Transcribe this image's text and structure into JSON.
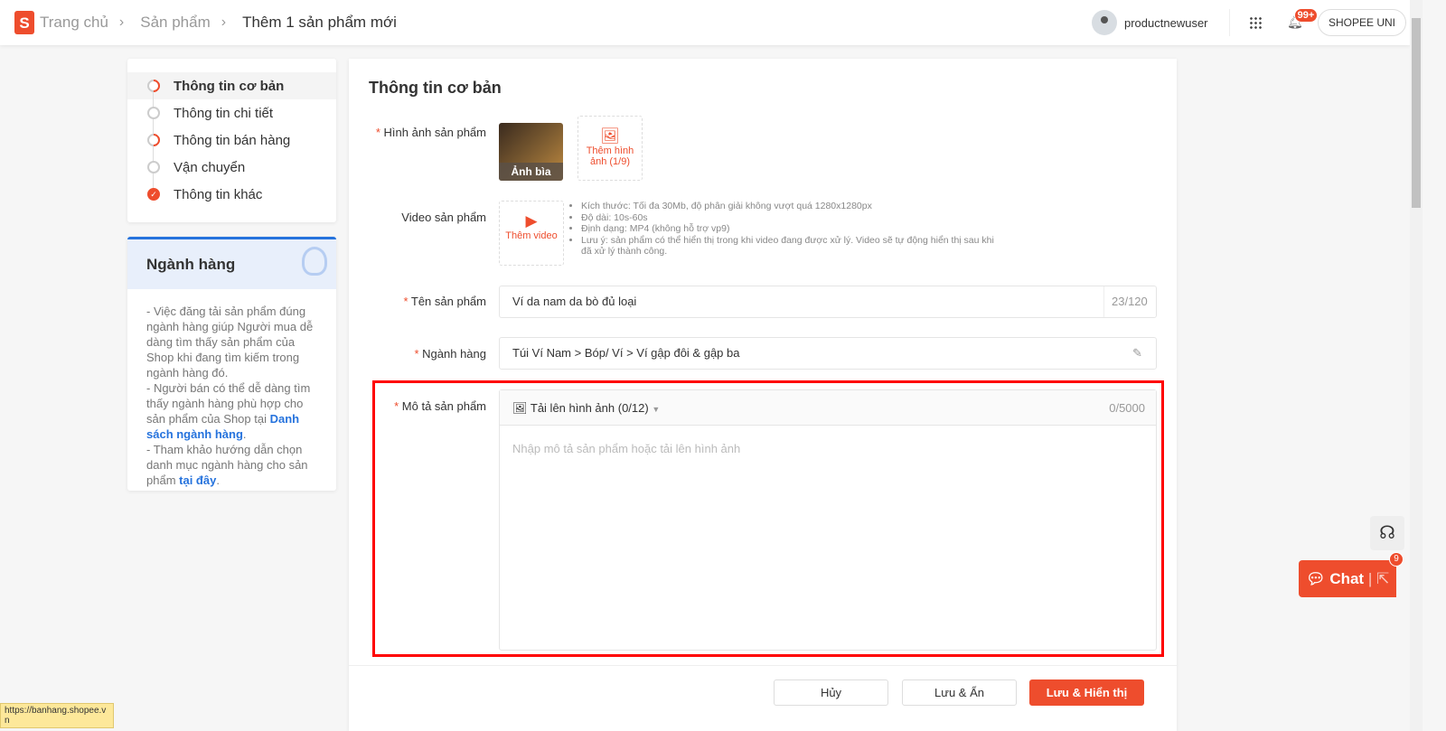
{
  "breadcrumb": [
    "Trang chủ",
    "Sản phẩm",
    "Thêm 1 sản phẩm mới"
  ],
  "header": {
    "username": "productnewuser",
    "notification_count": "99+",
    "uni_label": "SHOPEE UNI"
  },
  "steps": [
    {
      "label": "Thông tin cơ bản",
      "state": "in-progress",
      "active": true
    },
    {
      "label": "Thông tin chi tiết",
      "state": "empty"
    },
    {
      "label": "Thông tin bán hàng",
      "state": "in-progress"
    },
    {
      "label": "Vận chuyển",
      "state": "empty"
    },
    {
      "label": "Thông tin khác",
      "state": "done"
    }
  ],
  "tip": {
    "title": "Ngành hàng",
    "p1": "- Việc đăng tải sản phẩm đúng ngành hàng giúp Người mua dễ dàng tìm thấy sản phẩm của Shop khi đang tìm kiếm trong ngành hàng đó.",
    "p2": "- Người bán có thể dễ dàng tìm thấy ngành hàng phù hợp cho sản phẩm của Shop tại ",
    "link1": "Danh sách ngành hàng",
    "p3": "- Tham khảo hướng dẫn chọn danh mục ngành hàng cho sản phẩm ",
    "link2": "tại đây"
  },
  "form": {
    "title": "Thông tin cơ bản",
    "images_label": "Hình ảnh sản phẩm",
    "cover_label": "Ảnh bìa",
    "add_image": "Thêm hình ảnh (1/9)",
    "video_label": "Video sản phẩm",
    "add_video": "Thêm video",
    "video_info": [
      "Kích thước: Tối đa 30Mb, độ phân giải không vượt quá 1280x1280px",
      "Độ dài: 10s-60s",
      "Định dạng: MP4 (không hỗ trợ vp9)",
      "Lưu ý: sản phẩm có thể hiển thị trong khi video đang được xử lý. Video sẽ tự động hiển thị sau khi đã xử lý thành công."
    ],
    "name_label": "Tên sản phẩm",
    "name_value": "Ví da nam da bò đủ loại",
    "name_count": "23/120",
    "category_label": "Ngành hàng",
    "category_value": "Túi Ví Nam > Bóp/ Ví > Ví gập đôi & gập ba",
    "desc_label": "Mô tả sản phẩm",
    "upload_label": "Tải lên hình ảnh (0/12)",
    "desc_count": "0/5000",
    "desc_placeholder": "Nhập mô tả sản phẩm hoặc tải lên hình ảnh"
  },
  "footer": {
    "cancel": "Hủy",
    "save_hide": "Lưu & Ẩn",
    "save_show": "Lưu & Hiển thị"
  },
  "status_url": "https://banhang.shopee.vn",
  "chat": {
    "label": "Chat",
    "badge": "9"
  },
  "colors": {
    "brand": "#ee4d2d",
    "link": "#2673dd",
    "highlight": "#ff0000"
  }
}
